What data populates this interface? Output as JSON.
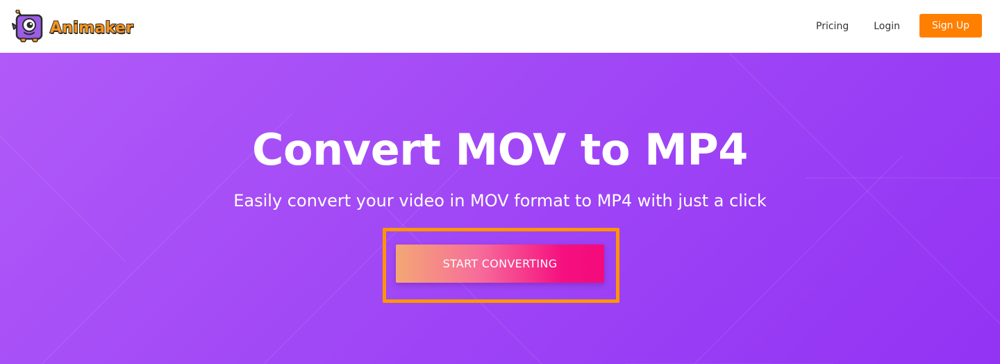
{
  "header": {
    "brand_name": "Animaker",
    "nav": {
      "pricing_label": "Pricing",
      "login_label": "Login",
      "signup_label": "Sign Up"
    }
  },
  "hero": {
    "title": "Convert MOV to MP4",
    "subtitle": "Easily convert your video in MOV format to MP4 with just a click",
    "cta_label": "START CONVERTING"
  },
  "colors": {
    "brand_orange": "#ff7f00",
    "hero_purple_start": "#b15af8",
    "hero_purple_end": "#9233f4",
    "cta_gradient_start": "#f3a774",
    "cta_gradient_end": "#f40a7c",
    "highlight_border": "#ff9500"
  },
  "icons": {
    "logo": "animaker-mascot-icon"
  }
}
